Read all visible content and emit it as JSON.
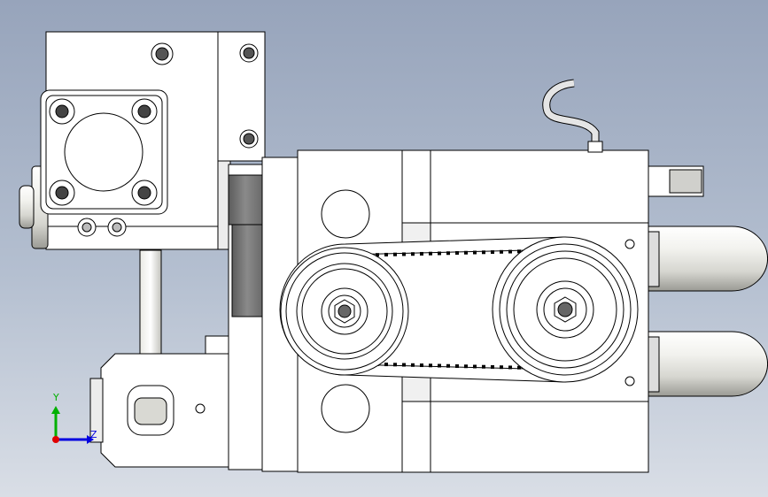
{
  "viewport": {
    "background_top": "#97a4bb",
    "background_bottom": "#d9dee6"
  },
  "model": {
    "line_color": "#000000",
    "face_color": "#ffffff",
    "shade_color": "#c9c9c9",
    "dark_shade_color": "#7a7a7a"
  },
  "triad": {
    "y_label": "Y",
    "z_label": "Z",
    "x_axis_color": "#e00000",
    "y_axis_color": "#00b000",
    "z_axis_color": "#0000e0"
  }
}
